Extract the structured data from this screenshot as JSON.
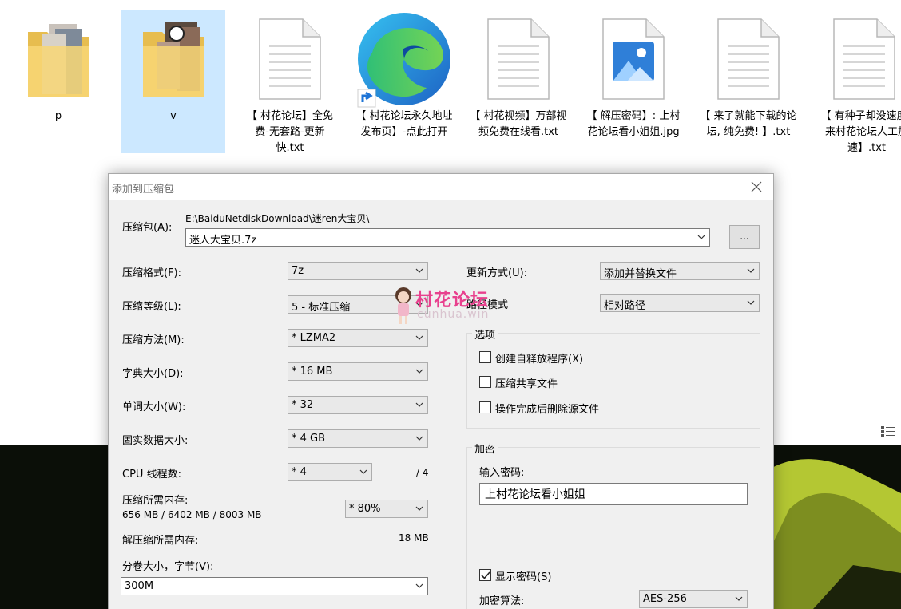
{
  "desktop": {
    "icons": [
      {
        "label": "p",
        "type": "folder"
      },
      {
        "label": "v",
        "type": "folder",
        "selected": true
      },
      {
        "label": "【 村花论坛】全免费-无套路-更新快.txt",
        "type": "text-file"
      },
      {
        "label": "【 村花论坛永久地址发布页】-点此打开",
        "type": "edge-shortcut"
      },
      {
        "label": "【 村花视频】万部视频免费在线看.txt",
        "type": "text-file"
      },
      {
        "label": "【 解压密码】: 上村花论坛看小姐姐.jpg",
        "type": "image-file"
      },
      {
        "label": "【 来了就能下载的论坛, 纯免费! 】.txt",
        "type": "text-file"
      },
      {
        "label": "【 有种子却没速度? 来村花论坛人工加速】.txt",
        "type": "text-file"
      }
    ]
  },
  "dialog": {
    "title": "添加到压缩包",
    "archive_label": "压缩包(A):",
    "archive_path": "E:\\BaiduNetdiskDownload\\迷ren大宝贝\\",
    "archive_name": "迷人大宝贝.7z",
    "browse_label": "...",
    "left": {
      "format_label": "压缩格式(F):",
      "format_value": "7z",
      "level_label": "压缩等级(L):",
      "level_value": "5 - 标准压缩",
      "method_label": "压缩方法(M):",
      "method_value": "* LZMA2",
      "dict_label": "字典大小(D):",
      "dict_value": "* 16 MB",
      "word_label": "单词大小(W):",
      "word_value": "* 32",
      "solid_label": "固实数据大小:",
      "solid_value": "* 4 GB",
      "cpu_label": "CPU 线程数:",
      "cpu_value": "* 4",
      "cpu_max": "/ 4",
      "mem_label": "压缩所需内存:",
      "mem_detail": "656 MB / 6402 MB / 8003 MB",
      "mem_value": "* 80%",
      "decomp_label": "解压缩所需内存:",
      "decomp_value": "18 MB",
      "split_label": "分卷大小，字节(V):",
      "split_value": "300M"
    },
    "right": {
      "update_label": "更新方式(U):",
      "update_value": "添加并替换文件",
      "path_label": "路径模式",
      "path_value": "相对路径",
      "options_title": "选项",
      "options": [
        {
          "label": "创建自释放程序(X)",
          "checked": false
        },
        {
          "label": "压缩共享文件",
          "checked": false
        },
        {
          "label": "操作完成后删除源文件",
          "checked": false
        }
      ],
      "encrypt_title": "加密",
      "password_label": "输入密码:",
      "password_value": "上村花论坛看小姐姐",
      "show_password_label": "显示密码(S)",
      "show_password_checked": true,
      "algo_label": "加密算法:",
      "algo_value": "AES-256"
    }
  },
  "watermark": {
    "text": "村花论坛",
    "url": "cunhua.win"
  },
  "colors": {
    "selection": "#cce8ff",
    "dialog_bg": "#f0f0f0",
    "watermark_pink": "#e8418e",
    "folder_yellow": "#f8d775"
  }
}
